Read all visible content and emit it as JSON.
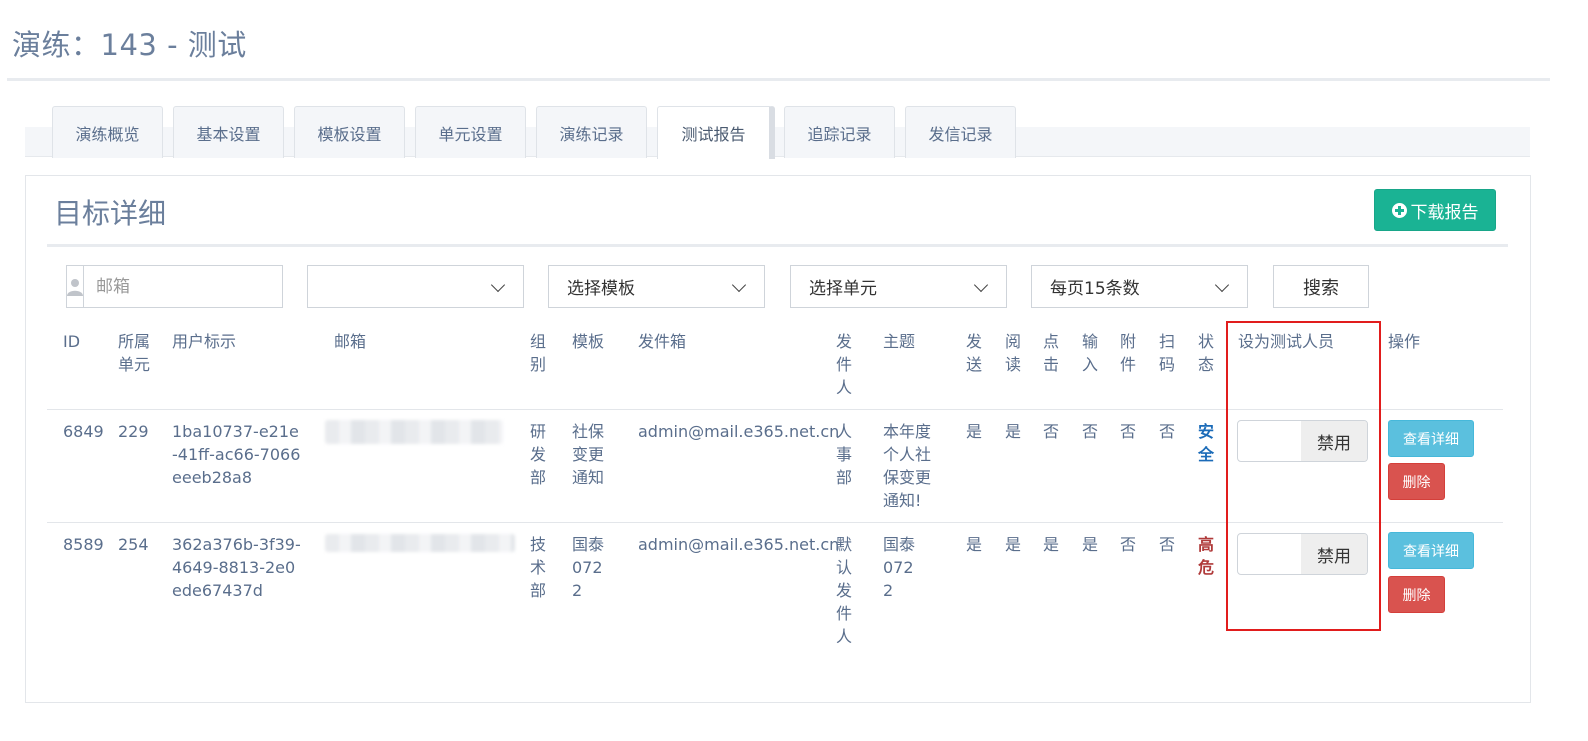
{
  "page": {
    "title": "演练：143 - 测试"
  },
  "tabs": [
    {
      "label": "演练概览",
      "active": false
    },
    {
      "label": "基本设置",
      "active": false
    },
    {
      "label": "模板设置",
      "active": false
    },
    {
      "label": "单元设置",
      "active": false
    },
    {
      "label": "演练记录",
      "active": false
    },
    {
      "label": "测试报告",
      "active": true
    },
    {
      "label": "追踪记录",
      "active": false
    },
    {
      "label": "发信记录",
      "active": false
    }
  ],
  "panel": {
    "title": "目标详细",
    "download_label": "下载报告"
  },
  "filters": {
    "email_placeholder": "邮箱",
    "group_select": "",
    "template_select": "选择模板",
    "unit_select": "选择单元",
    "page_size_select": "每页15条数",
    "search_label": "搜索"
  },
  "table": {
    "headers": {
      "id": "ID",
      "unit": "所属单元",
      "user_tag": "用户标示",
      "email": "邮箱",
      "group": "组别",
      "template": "模板",
      "sender_box": "发件箱",
      "sender": "发件人",
      "subject": "主题",
      "sent": "发送",
      "read": "阅读",
      "click": "点击",
      "input": "输入",
      "attachment": "附件",
      "scan": "扫码",
      "status": "状态",
      "tester": "设为测试人员",
      "ops": "操作"
    },
    "rows": [
      {
        "id": "6849",
        "unit": "229",
        "user_tag": "1ba10737-e21e-41ff-ac66-7066eeeb28a8",
        "group": "研发部",
        "template": "社保变更通知",
        "sender_box": "admin@mail.e365.net.cn",
        "sender": "人事部",
        "subject": "本年度个人社保变更通知!",
        "sent": "是",
        "read": "是",
        "click": "否",
        "input": "否",
        "attachment": "否",
        "scan": "否",
        "status": "安全",
        "toggle_label": "禁用",
        "detail_label": "查看详细",
        "delete_label": "删除"
      },
      {
        "id": "8589",
        "unit": "254",
        "user_tag": "362a376b-3f39-4649-8813-2e0ede67437d",
        "group": "技术部",
        "template": "国泰0722",
        "sender_box": "admin@mail.e365.net.cn",
        "sender": "默认发件人",
        "subject": "国泰0722",
        "sent": "是",
        "read": "是",
        "click": "是",
        "input": "是",
        "attachment": "否",
        "scan": "否",
        "status": "高危",
        "toggle_label": "禁用",
        "detail_label": "查看详细",
        "delete_label": "删除"
      }
    ]
  },
  "colors": {
    "accent_green": "#1ab394",
    "info_blue": "#5bc0de",
    "danger_red": "#d9534f",
    "highlight_red": "#e11d1d",
    "status_safe": "#1b6bb8",
    "status_high": "#b03a3a"
  }
}
